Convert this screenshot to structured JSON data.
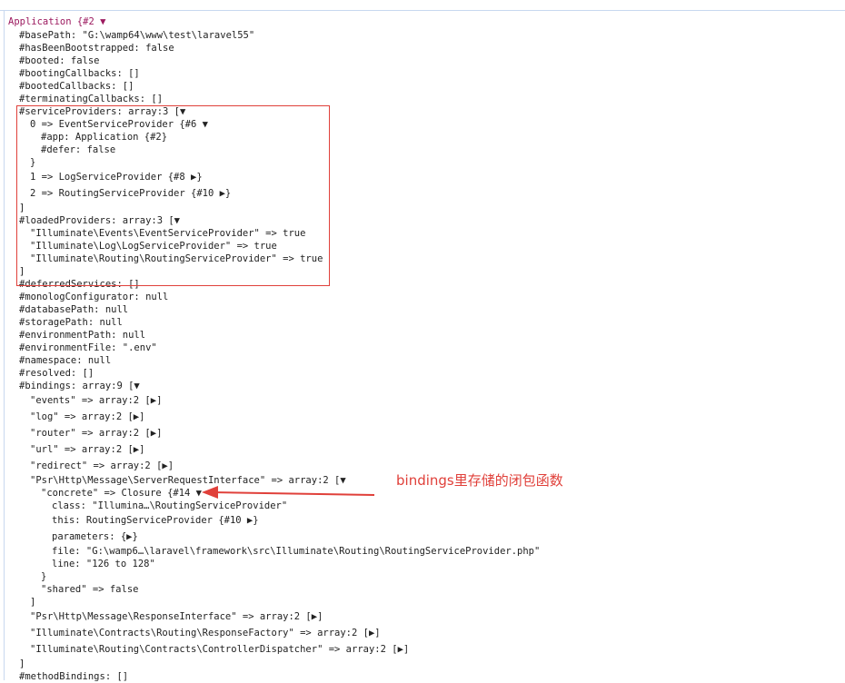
{
  "lines": [
    {
      "text": "Application {#2 ▼"
    },
    {
      "text": "#basePath: \"G:\\wamp64\\www\\test\\laravel55\""
    },
    {
      "text": "#hasBeenBootstrapped: false"
    },
    {
      "text": "#booted: false"
    },
    {
      "text": "#bootingCallbacks: []"
    },
    {
      "text": "#bootedCallbacks: []"
    },
    {
      "text": "#terminatingCallbacks: []"
    },
    {
      "text": "#serviceProviders: array:3 [▼"
    },
    {
      "text": "0 => EventServiceProvider {#6 ▼"
    },
    {
      "text": "#app: Application {#2}"
    },
    {
      "text": "#defer: false"
    },
    {
      "text": "}"
    },
    {
      "text": "1 => LogServiceProvider {#8 ▶}"
    },
    {
      "text": "2 => RoutingServiceProvider {#10 ▶}"
    },
    {
      "text": "]"
    },
    {
      "text": "#loadedProviders: array:3 [▼"
    },
    {
      "text": "\"Illuminate\\Events\\EventServiceProvider\" => true"
    },
    {
      "text": "\"Illuminate\\Log\\LogServiceProvider\" => true"
    },
    {
      "text": "\"Illuminate\\Routing\\RoutingServiceProvider\" => true"
    },
    {
      "text": "]"
    },
    {
      "text": "#deferredServices: []"
    },
    {
      "text": "#monologConfigurator: null"
    },
    {
      "text": "#databasePath: null"
    },
    {
      "text": "#storagePath: null"
    },
    {
      "text": "#environmentPath: null"
    },
    {
      "text": "#environmentFile: \".env\""
    },
    {
      "text": "#namespace: null"
    },
    {
      "text": "#resolved: []"
    },
    {
      "text": "#bindings: array:9 [▼"
    },
    {
      "text": "\"events\" => array:2 [▶]"
    },
    {
      "text": "\"log\" => array:2 [▶]"
    },
    {
      "text": "\"router\" => array:2 [▶]"
    },
    {
      "text": "\"url\" => array:2 [▶]"
    },
    {
      "text": "\"redirect\" => array:2 [▶]"
    },
    {
      "text": "\"Psr\\Http\\Message\\ServerRequestInterface\" => array:2 [▼"
    },
    {
      "text": "\"concrete\" => Closure {#14 ▼"
    },
    {
      "text": "class: \"Illumina…\\RoutingServiceProvider\""
    },
    {
      "text": "this: RoutingServiceProvider {#10 ▶}"
    },
    {
      "text": "parameters: {▶}"
    },
    {
      "text": "file: \"G:\\wamp6…\\laravel\\framework\\src\\Illuminate\\Routing\\RoutingServiceProvider.php\""
    },
    {
      "text": "line: \"126 to 128\""
    },
    {
      "text": "}"
    },
    {
      "text": "\"shared\" => false"
    },
    {
      "text": "]"
    },
    {
      "text": "\"Psr\\Http\\Message\\ResponseInterface\" => array:2 [▶]"
    },
    {
      "text": "\"Illuminate\\Contracts\\Routing\\ResponseFactory\" => array:2 [▶]"
    },
    {
      "text": "\"Illuminate\\Routing\\Contracts\\ControllerDispatcher\" => array:2 [▶]"
    },
    {
      "text": "]"
    },
    {
      "text": "#methodBindings: []"
    }
  ],
  "annotation": {
    "text": "bindings里存储的闭包函数"
  },
  "colors": {
    "highlight_box": "#e0403a",
    "annotation": "#e0403a",
    "frame": "#c8d8ef"
  }
}
